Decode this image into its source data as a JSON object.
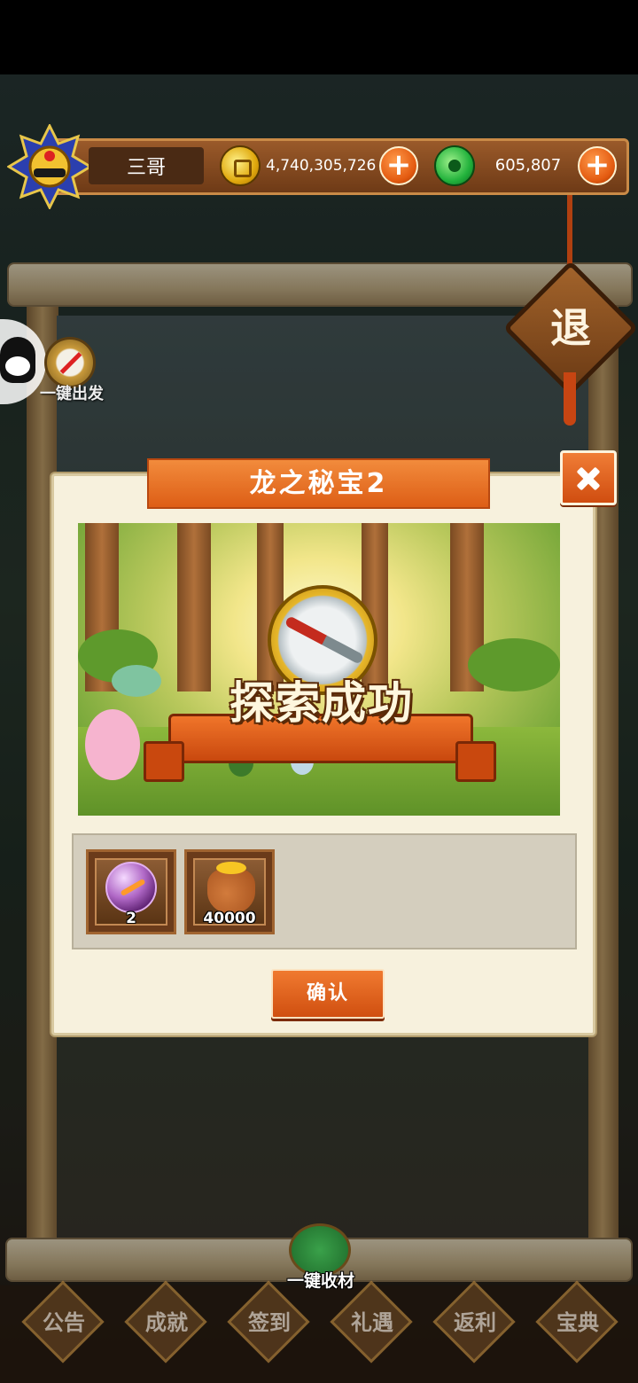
{
  "player": {
    "name": "三哥",
    "gold": "4,740,305,726",
    "jade": "605,807"
  },
  "map": {
    "retreat_label": "退",
    "one_key_depart": "一键出发",
    "one_key_collect": "一键收材"
  },
  "dialog": {
    "title": "龙之秘宝2",
    "result_banner": "探索成功",
    "rewards": [
      {
        "icon": "purple-orb-icon",
        "count": "2"
      },
      {
        "icon": "gold-bag-icon",
        "count": "40000"
      }
    ],
    "confirm_label": "确认"
  },
  "bottom_nav": [
    {
      "label": "公告"
    },
    {
      "label": "成就"
    },
    {
      "label": "签到"
    },
    {
      "label": "礼遇"
    },
    {
      "label": "返利"
    },
    {
      "label": "宝典"
    }
  ],
  "colors": {
    "accent_orange": "#dd5e16",
    "dialog_bg": "#f7f1dd",
    "gold": "#e0a90e",
    "jade": "#22b23c"
  }
}
